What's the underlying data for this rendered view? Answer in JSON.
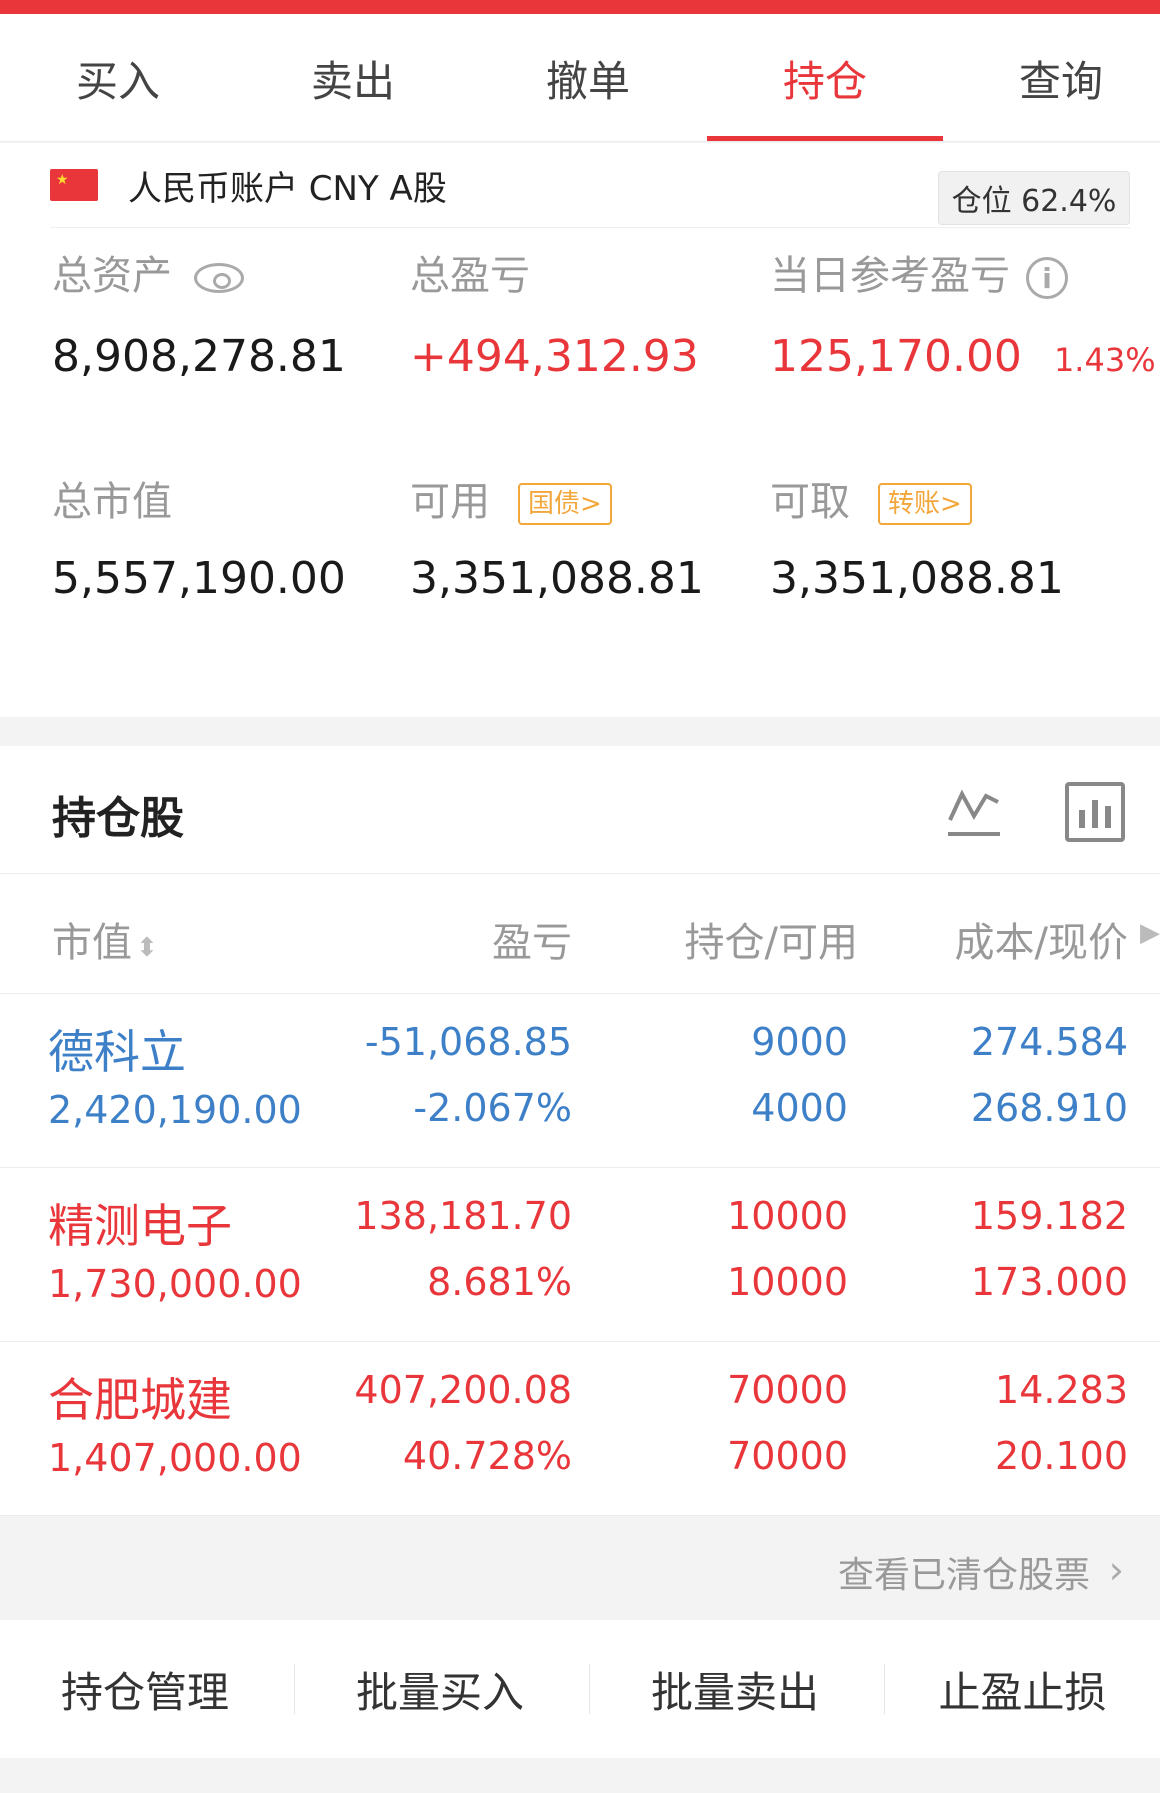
{
  "tabs": [
    "买入",
    "卖出",
    "撤单",
    "持仓",
    "查询"
  ],
  "active_tab": "持仓",
  "account": {
    "name": "人民币账户 CNY A股",
    "position_ratio": "仓位 62.4%",
    "total_assets_label": "总资产",
    "total_assets": "8,908,278.81",
    "total_pnl_label": "总盈亏",
    "total_pnl": "+494,312.93",
    "daily_pnl_label": "当日参考盈亏",
    "daily_pnl": "125,170.00",
    "daily_pnl_pct": "1.43%",
    "market_value_label": "总市值",
    "market_value": "5,557,190.00",
    "available_label": "可用",
    "available_tag": "国债>",
    "available": "3,351,088.81",
    "withdrawable_label": "可取",
    "withdrawable_tag": "转账>",
    "withdrawable": "3,351,088.81"
  },
  "holdings": {
    "title": "持仓股",
    "columns": [
      "市值",
      "盈亏",
      "持仓/可用",
      "成本/现价"
    ],
    "rows": [
      {
        "name": "德科立",
        "market_value": "2,420,190.00",
        "pnl": "-51,068.85",
        "pnl_pct": "-2.067%",
        "holding": "9000",
        "available": "4000",
        "cost": "274.584",
        "price": "268.910",
        "color": "#3d80c8"
      },
      {
        "name": "精测电子",
        "market_value": "1,730,000.00",
        "pnl": "138,181.70",
        "pnl_pct": "8.681%",
        "holding": "10000",
        "available": "10000",
        "cost": "159.182",
        "price": "173.000",
        "color": "#e8363b"
      },
      {
        "name": "合肥城建",
        "market_value": "1,407,000.00",
        "pnl": "407,200.08",
        "pnl_pct": "40.728%",
        "holding": "70000",
        "available": "70000",
        "cost": "14.283",
        "price": "20.100",
        "color": "#e8363b"
      }
    ]
  },
  "view_cleared": "查看已清仓股票",
  "actions": [
    "持仓管理",
    "批量买入",
    "批量卖出",
    "止盈止损"
  ]
}
